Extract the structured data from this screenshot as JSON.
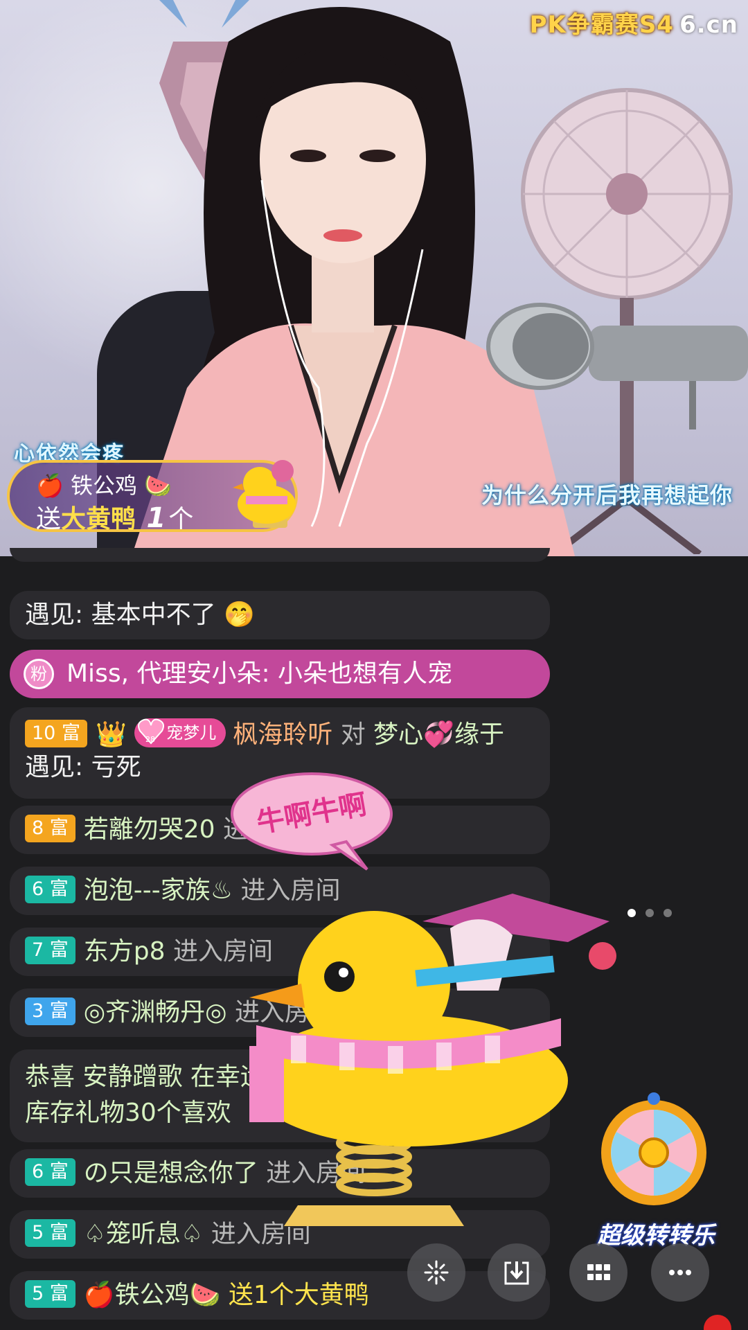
{
  "stream": {
    "logo_text": "PK争霸赛S4",
    "logo_domain": "6.cn",
    "song_lyric_left": "心依然会疼",
    "song_lyric_right": "为什么分开后我再想起你"
  },
  "gift_banner": {
    "user": "铁公鸡",
    "send_word": "送",
    "gift_name": "大黄鸭",
    "count": "1",
    "unit": "个"
  },
  "chat": {
    "messages": [
      {
        "text": "遇见: 基本中不了"
      },
      {
        "badge": "粉",
        "text": "Miss, 代理安小朵: 小朵也想有人宠"
      },
      {
        "level": "10 富",
        "pet_badge": "宠梦儿",
        "pet_level": "28",
        "user": "枫海聆听",
        "verb": "对",
        "target": "梦心",
        "target2": "缘于",
        "line2": "遇见: 亏死"
      },
      {
        "level": "8 富",
        "user": "若離勿哭20",
        "action": "进入房间"
      },
      {
        "level": "6 富",
        "user": "泡泡---家族♨",
        "action": "进入房间"
      },
      {
        "level": "7 富",
        "user": "东方p8",
        "action": "进入房间"
      },
      {
        "level": "3 富",
        "user": "◎齐渊畅丹◎",
        "action": "进入房间"
      },
      {
        "line1": "恭喜 安静蹭歌 在幸运",
        "line2": "库存礼物30个喜欢"
      },
      {
        "level": "6 富",
        "user": "の只是想念你了",
        "action": "进入房间"
      },
      {
        "level": "5 富",
        "user": "♤笼听息♤",
        "action": "进入房间"
      },
      {
        "level": "5 富",
        "user": "铁公鸡",
        "action": "送1个大黄鸭"
      }
    ]
  },
  "bubble_text": "牛啊牛啊",
  "wheel_label": "超级转转乐",
  "toolbar": {
    "buttons": [
      "share-icon",
      "download-icon",
      "grid-icon",
      "more-icon"
    ]
  },
  "pager": {
    "count": 3,
    "active": 0
  },
  "colors": {
    "chat_bg": "#1d1d1f",
    "bubble_bg": "#2b2a2e",
    "fan_msg": "#c2489b",
    "level_gold": "#f4a51f",
    "level_teal": "#1bb8a3",
    "level_blue": "#3fa5ec",
    "accent_yellow": "#ffe44d"
  }
}
